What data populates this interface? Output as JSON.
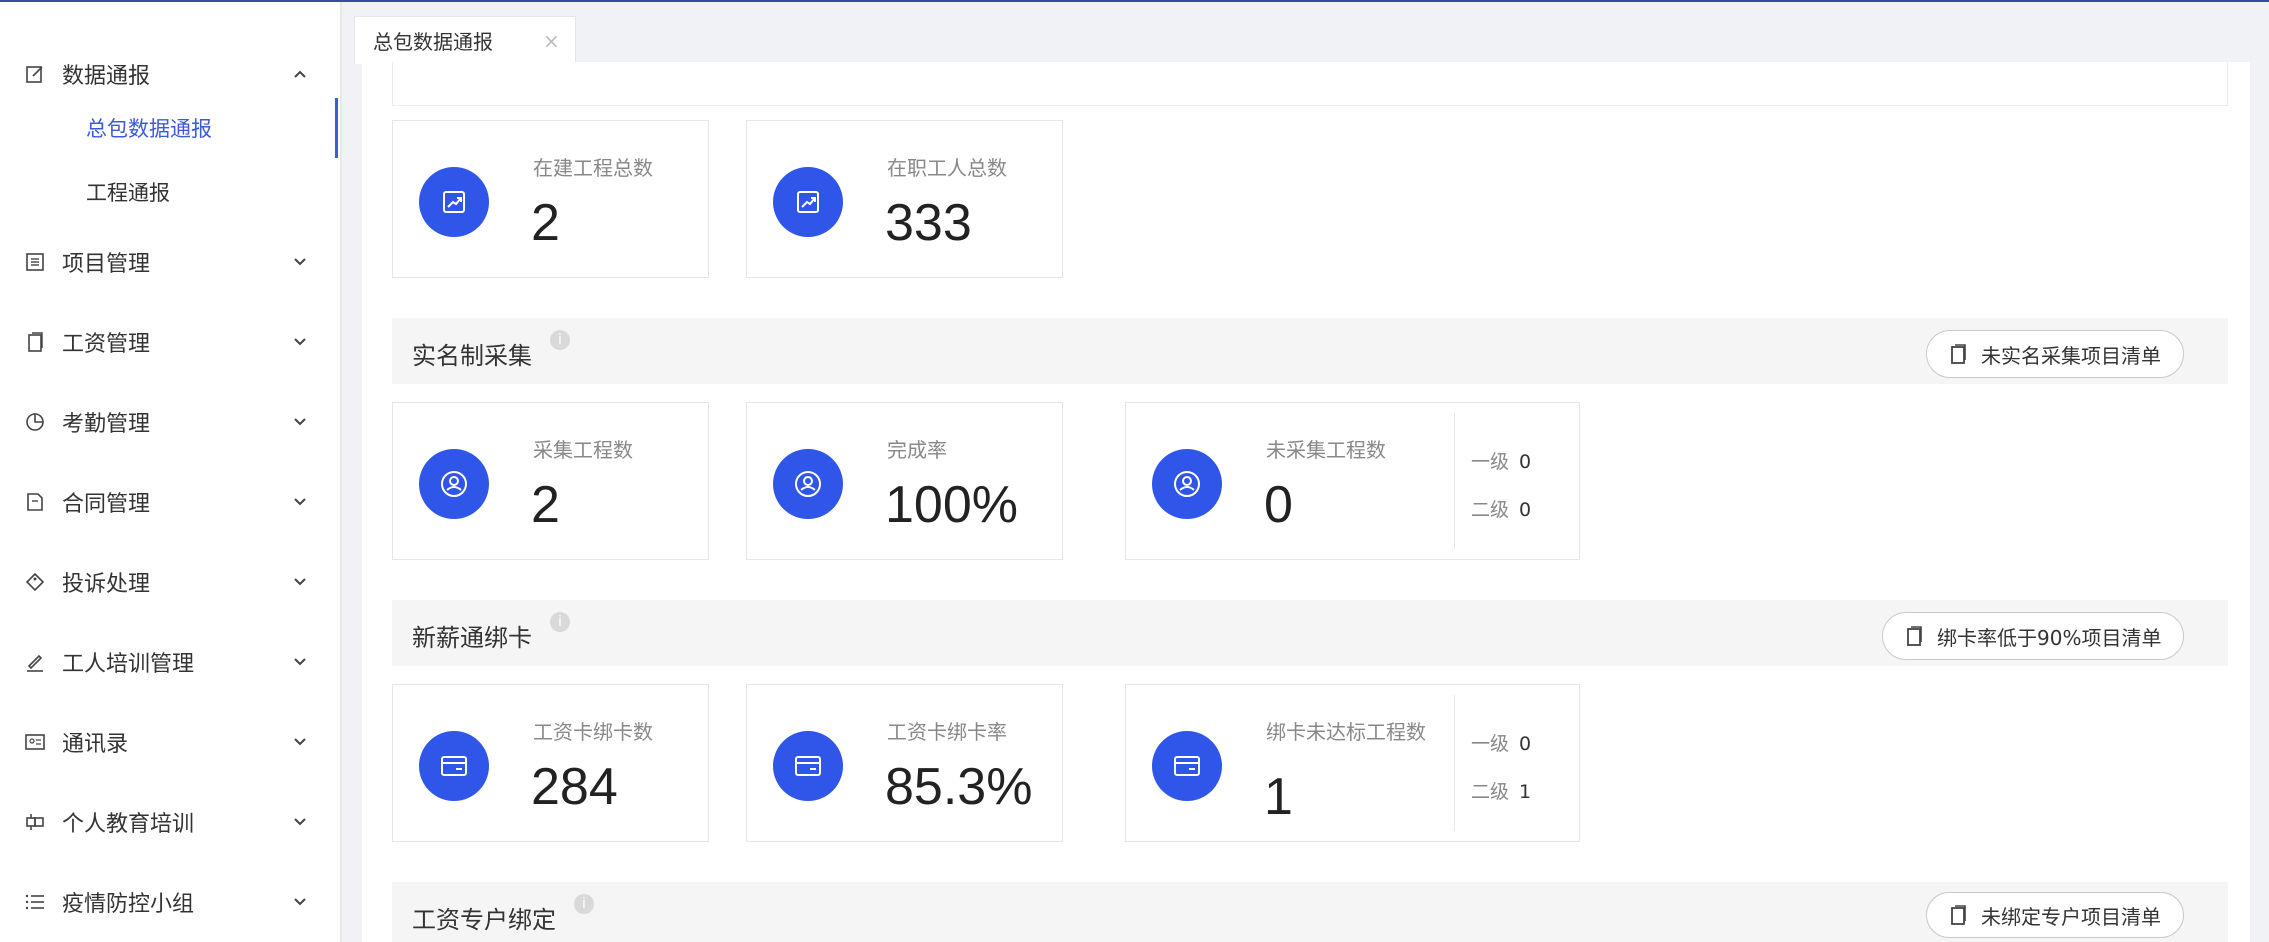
{
  "sidebar": {
    "items": [
      {
        "label": "数据通报",
        "icon": "edit-icon",
        "expanded": true
      },
      {
        "label": "项目管理",
        "icon": "list-icon"
      },
      {
        "label": "工资管理",
        "icon": "copy-icon"
      },
      {
        "label": "考勤管理",
        "icon": "pie-chart-icon"
      },
      {
        "label": "合同管理",
        "icon": "document-icon"
      },
      {
        "label": "投诉处理",
        "icon": "tag-icon"
      },
      {
        "label": "工人培训管理",
        "icon": "pen-icon"
      },
      {
        "label": "通讯录",
        "icon": "contact-card-icon"
      },
      {
        "label": "个人教育培训",
        "icon": "blocks-icon"
      },
      {
        "label": "疫情防控小组",
        "icon": "menu-icon"
      }
    ],
    "sub_items": [
      {
        "label": "总包数据通报",
        "active": true
      },
      {
        "label": "工程通报",
        "active": false
      }
    ]
  },
  "tabs": [
    {
      "label": "总包数据通报",
      "close": "×"
    }
  ],
  "overview": {
    "cards": [
      {
        "title": "在建工程总数",
        "value": "2",
        "icon": "trend-chart-icon"
      },
      {
        "title": "在职工人总数",
        "value": "333",
        "icon": "trend-chart-icon"
      }
    ]
  },
  "sections": [
    {
      "title": "实名制采集",
      "button": "未实名采集项目清单",
      "cards": [
        {
          "title": "采集工程数",
          "value": "2",
          "icon": "user-circle-icon"
        },
        {
          "title": "完成率",
          "value": "100%",
          "icon": "user-circle-icon"
        },
        {
          "title": "未采集工程数",
          "value": "0",
          "icon": "user-circle-icon",
          "levels": [
            {
              "label": "一级",
              "value": "0"
            },
            {
              "label": "二级",
              "value": "0"
            }
          ]
        }
      ]
    },
    {
      "title": "新薪通绑卡",
      "button": "绑卡率低于90%项目清单",
      "cards": [
        {
          "title": "工资卡绑卡数",
          "value": "284",
          "icon": "bank-card-icon"
        },
        {
          "title": "工资卡绑卡率",
          "value": "85.3%",
          "icon": "bank-card-icon"
        },
        {
          "title": "绑卡未达标工程数",
          "value": "1",
          "icon": "bank-card-icon",
          "levels": [
            {
              "label": "一级",
              "value": "0"
            },
            {
              "label": "二级",
              "value": "1"
            }
          ]
        }
      ]
    },
    {
      "title": "工资专户绑定",
      "button": "未绑定专户项目清单"
    }
  ],
  "colors": {
    "accent": "#2f56e8",
    "active_text": "#3b5bdb",
    "topline": "#3a4a9e"
  }
}
